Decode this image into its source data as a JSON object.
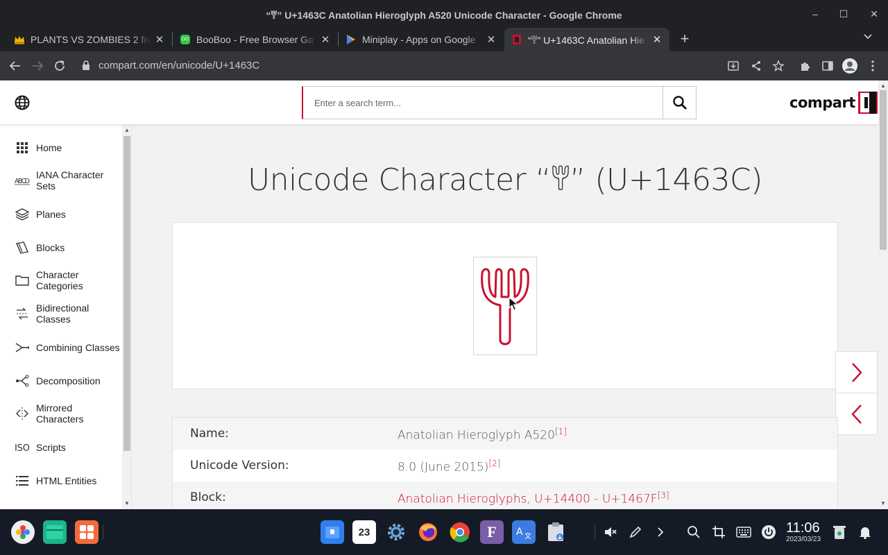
{
  "window": {
    "title": "“𔘼” U+1463C Anatolian Hieroglyph A520 Unicode Character - Google Chrome",
    "minimize": "–",
    "maximize": "☐",
    "close": "✕"
  },
  "tabs": [
    {
      "label": "PLANTS VS ZOMBIES 2 free",
      "icon": "crown-icon",
      "close": "✕"
    },
    {
      "label": "BooBoo - Free Browser Ga",
      "icon": "booboo-icon",
      "close": "✕"
    },
    {
      "label": "Miniplay - Apps on Google",
      "icon": "play-store-icon",
      "close": "✕"
    },
    {
      "label": "“𔘼” U+1463C Anatolian Hie",
      "icon": "compart-icon",
      "close": "✕"
    }
  ],
  "new_tab": "+",
  "tab_search": "⌄",
  "toolbar": {
    "url": "compart.com/en/unicode/U+1463C"
  },
  "site": {
    "search_placeholder": "Enter a search term...",
    "logo_text": "compart"
  },
  "sidebar": {
    "items": [
      {
        "label": "Home",
        "icon": "grid-icon"
      },
      {
        "label": "IANA Character Sets",
        "icon": "abcd-icon"
      },
      {
        "label": "Planes",
        "icon": "layers-icon"
      },
      {
        "label": "Blocks",
        "icon": "blocks-icon"
      },
      {
        "label": "Character Categories",
        "icon": "folder-icon"
      },
      {
        "label": "Bidirectional Classes",
        "icon": "bidi-icon"
      },
      {
        "label": "Combining Classes",
        "icon": "combining-icon"
      },
      {
        "label": "Decomposition",
        "icon": "decomposition-icon"
      },
      {
        "label": "Mirrored Characters",
        "icon": "mirror-icon"
      },
      {
        "label": "Scripts",
        "icon": "iso-icon"
      },
      {
        "label": "HTML Entities",
        "icon": "list-icon"
      }
    ]
  },
  "main": {
    "title": "Unicode Character “𔘼” (U+1463C)",
    "glyph_color": "#c8102e",
    "info": [
      {
        "key": "Name:",
        "value": "Anatolian Hieroglyph A520",
        "ref": "[1]",
        "link": false
      },
      {
        "key": "Unicode Version:",
        "value": "8.0 (June 2015)",
        "ref": "[2]",
        "link": false
      },
      {
        "key": "Block:",
        "value": "Anatolian Hieroglyphs, U+14400 - U+1467F",
        "ref": "[3]",
        "link": true
      }
    ]
  },
  "taskbar": {
    "time": "11:06",
    "date": "2023/03/23",
    "calendar_day": "23"
  }
}
